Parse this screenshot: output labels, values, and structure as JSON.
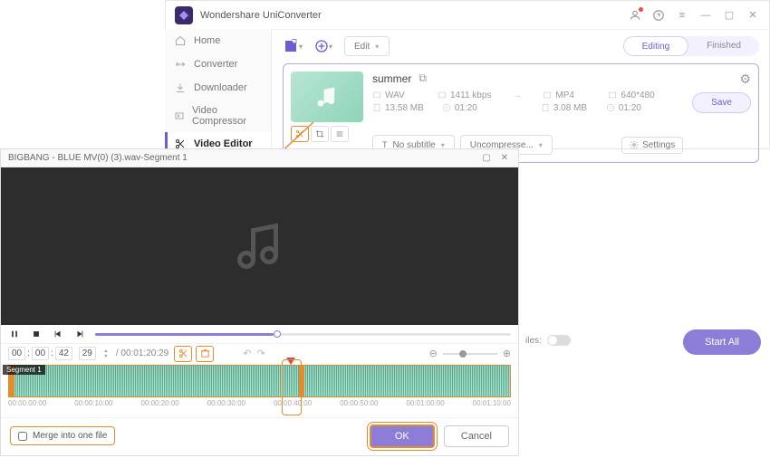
{
  "app": {
    "title": "Wondershare UniConverter"
  },
  "sidebar": {
    "items": [
      {
        "label": "Home"
      },
      {
        "label": "Converter"
      },
      {
        "label": "Downloader"
      },
      {
        "label": "Video Compressor"
      },
      {
        "label": "Video Editor"
      }
    ]
  },
  "toolbar": {
    "edit_label": "Edit",
    "tabs": {
      "editing": "Editing",
      "finished": "Finished"
    }
  },
  "file": {
    "name": "summer",
    "src": {
      "format": "WAV",
      "bitrate": "1411 kbps",
      "size": "13.58 MB",
      "duration": "01:20"
    },
    "dst": {
      "format": "MP4",
      "resolution": "640*480",
      "size": "3.08 MB",
      "duration": "01:20"
    },
    "subtitle": "No subtitle",
    "compress": "Uncompresse...",
    "settings": "Settings",
    "save": "Save"
  },
  "bottom": {
    "merge_label": "iles:",
    "start_all": "Start All"
  },
  "editor": {
    "title": "BIGBANG - BLUE MV(0) (3).wav-Segment 1",
    "time_parts": [
      "00",
      "00",
      "42",
      "29"
    ],
    "time_total": "/ 00:01:20:29",
    "segment_label": "Segment 1",
    "timecodes": [
      "00:00:00:00",
      "00:00:10:00",
      "00:00:20:00",
      "00:00:30:00",
      "00:00:40:00",
      "00:00:50:00",
      "00:01:00:00",
      "00:01:10:00"
    ],
    "merge": "Merge into one file",
    "ok": "OK",
    "cancel": "Cancel"
  }
}
